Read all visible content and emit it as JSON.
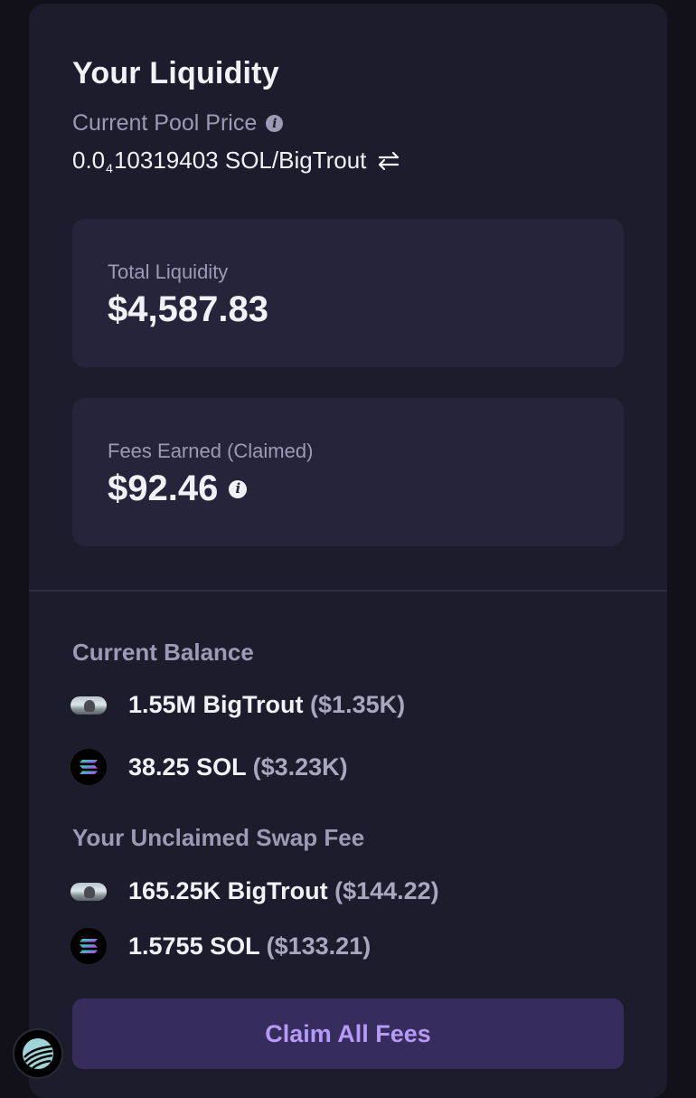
{
  "title": "Your Liquidity",
  "pool_price": {
    "label": "Current Pool Price",
    "value_prefix": "0.0",
    "value_subscript": "4",
    "value_rest": "10319403 SOL/BigTrout"
  },
  "total_liquidity": {
    "label": "Total Liquidity",
    "value": "$4,587.83"
  },
  "fees_earned": {
    "label": "Fees Earned (Claimed)",
    "value": "$92.46"
  },
  "current_balance": {
    "label": "Current Balance",
    "items": [
      {
        "amount": "1.55M BigTrout",
        "usd": "($1.35K)",
        "icon": "bigtrout-token-icon"
      },
      {
        "amount": "38.25 SOL",
        "usd": "($3.23K)",
        "icon": "sol-token-icon"
      }
    ]
  },
  "unclaimed_fees": {
    "label": "Your Unclaimed Swap Fee",
    "items": [
      {
        "amount": "165.25K BigTrout",
        "usd": "($144.22)",
        "icon": "bigtrout-token-icon"
      },
      {
        "amount": "1.5755 SOL",
        "usd": "($133.21)",
        "icon": "sol-token-icon"
      }
    ]
  },
  "claim_button": "Claim All Fees",
  "colors": {
    "card": "#1D1C2C",
    "stat_box": "#25243A",
    "accent": "#B69AF7",
    "button_bg": "#362D5C"
  }
}
